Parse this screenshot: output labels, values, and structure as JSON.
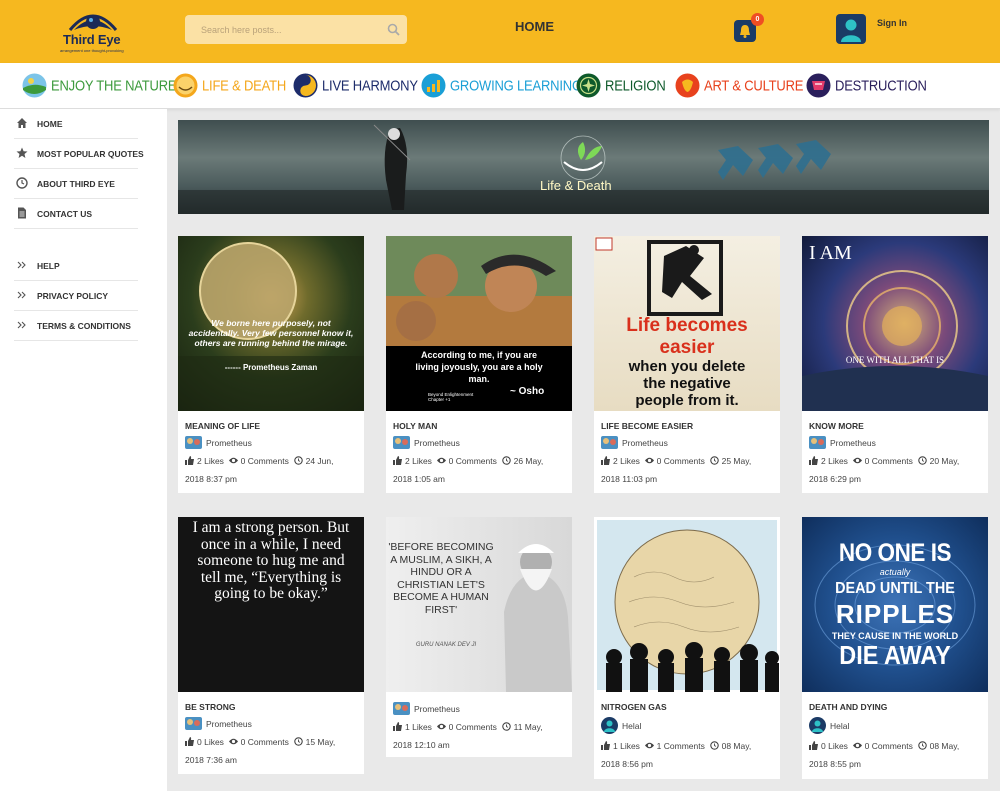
{
  "header": {
    "logo_text": "Third Eye",
    "logo_sub": "arrangement one thought-provoking",
    "search_placeholder": "Search here posts...",
    "home_label": "HOME",
    "cart_count": "0",
    "signin_label": "Sign In"
  },
  "categories": [
    {
      "label": "ENJOY THE NATURE",
      "color": "#3c9a3c"
    },
    {
      "label": "LIFE & DEATH",
      "color": "#f4a71c"
    },
    {
      "label": "LIVE HARMONY",
      "color": "#1d2c6b"
    },
    {
      "label": "GROWING LEARNING",
      "color": "#1a9fd6"
    },
    {
      "label": "RELIGION",
      "color": "#0e5a2b"
    },
    {
      "label": "ART & CULTURE",
      "color": "#e8421d"
    },
    {
      "label": "DESTRUCTION",
      "color": "#2a1f5c"
    }
  ],
  "sidebar": {
    "items": [
      {
        "label": "HOME",
        "icon": "home-icon"
      },
      {
        "label": "MOST POPULAR QUOTES",
        "icon": "star-icon"
      },
      {
        "label": "ABOUT THIRD EYE",
        "icon": "clock-icon"
      },
      {
        "label": "CONTACT US",
        "icon": "document-icon"
      },
      {
        "label": "HELP",
        "icon": "double-chevron-icon"
      },
      {
        "label": "PRIVACY POLICY",
        "icon": "double-chevron-icon"
      },
      {
        "label": "TERMS & CONDITIONS",
        "icon": "double-chevron-icon"
      }
    ]
  },
  "banner": {
    "title": "Life & Death"
  },
  "posts": [
    {
      "title": "MEANING OF LIFE",
      "author": "Prometheus",
      "likes": "2 Likes",
      "comments": "0 Comments",
      "date1": "24 Jun,",
      "date2": "2018 8:37 pm",
      "img_text": "We borne here purposely, not accidentally. Very few personnel know it, others are running behind the mirage.",
      "img_credit": "------ Prometheus Zaman"
    },
    {
      "title": "HOLY MAN",
      "author": "Prometheus",
      "likes": "2 Likes",
      "comments": "0 Comments",
      "date1": "26 May,",
      "date2": "2018 1:05 am",
      "img_text": "According to me, if you are living joyously, you are a holy man.",
      "img_credit": "~ Osho",
      "img_sub": "Beyond Enlightenment Chapter +1"
    },
    {
      "title": "LIFE BECOME EASIER",
      "author": "Prometheus",
      "likes": "2 Likes",
      "comments": "0 Comments",
      "date1": "25 May,",
      "date2": "2018 11:03 pm",
      "img_line1": "Life becomes",
      "img_line2": "easier",
      "img_line3": "when you delete",
      "img_line4": "the negative",
      "img_line5": "people from it."
    },
    {
      "title": "KNOW MORE",
      "author": "Prometheus",
      "likes": "2 Likes",
      "comments": "0 Comments",
      "date1": "20 May,",
      "date2": "2018 6:29 pm",
      "img_top": "I AM",
      "img_mid": "ONE WITH ALL THAT IS"
    },
    {
      "title": "BE STRONG",
      "author": "Prometheus",
      "likes": "0 Likes",
      "comments": "0 Comments",
      "date1": "15 May,",
      "date2": "2018 7:36 am",
      "img_text": "I am a strong person. But once in a while, I need someone to hug me and tell me, “Everything is going to be okay.”"
    },
    {
      "title": "",
      "author": "Prometheus",
      "likes": "1 Likes",
      "comments": "0 Comments",
      "date1": "11 May,",
      "date2": "2018 12:10 am",
      "img_text": "'BEFORE BECOMING A MUSLIM, A SIKH, A HINDU OR A CHRISTIAN LET'S BECOME A HUMAN FIRST'",
      "img_credit": "GURU NANAK DEV JI"
    },
    {
      "title": "NITROGEN GAS",
      "author": "Helal",
      "likes": "1 Likes",
      "comments": "1 Comments",
      "date1": "08 May,",
      "date2": "2018 8:56 pm"
    },
    {
      "title": "DEATH AND DYING",
      "author": "Helal",
      "likes": "0 Likes",
      "comments": "0 Comments",
      "date1": "08 May,",
      "date2": "2018 8:55 pm",
      "img_l1": "NO ONE IS",
      "img_l2": "actually",
      "img_l3": "DEAD UNTIL THE",
      "img_l4": "RIPPLES",
      "img_l5": "THEY CAUSE IN THE WORLD",
      "img_l6": "DIE AWAY"
    }
  ],
  "colors": {
    "header_bg": "#f6b81f",
    "accent_navy": "#1b3b66",
    "badge_red": "#ef4e23"
  }
}
